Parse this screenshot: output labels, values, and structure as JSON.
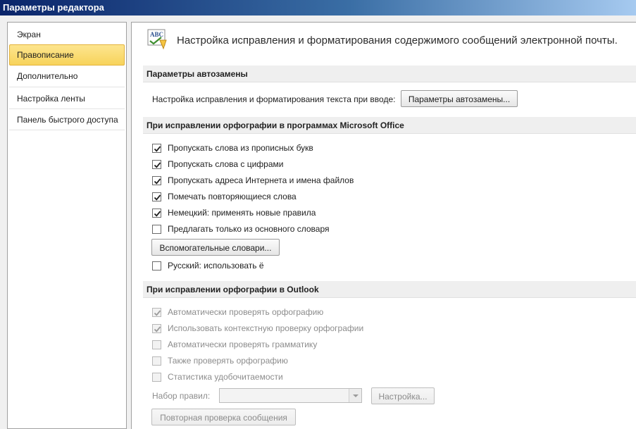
{
  "window": {
    "title": "Параметры редактора"
  },
  "sidebar": {
    "items": [
      {
        "label": "Экран",
        "active": false
      },
      {
        "label": "Правописание",
        "active": true
      },
      {
        "label": "Дополнительно",
        "active": false
      },
      {
        "label": "Настройка ленты",
        "active": false
      },
      {
        "label": "Панель быстрого доступа",
        "active": false
      }
    ]
  },
  "header": {
    "icon_text": "ABC",
    "text": "Настройка исправления и форматирования содержимого сообщений электронной почты."
  },
  "autocorrect": {
    "title": "Параметры автозамены",
    "row_label": "Настройка исправления и форматирования текста при вводе:",
    "button_label": "Параметры автозамены..."
  },
  "office_spelling": {
    "title": "При исправлении орфографии в программах Microsoft Office",
    "options": [
      {
        "label": "Пропускать слова из прописных букв",
        "checked": true
      },
      {
        "label": "Пропускать слова с цифрами",
        "checked": true
      },
      {
        "label": "Пропускать адреса Интернета и имена файлов",
        "checked": true
      },
      {
        "label": "Помечать повторяющиеся слова",
        "checked": true
      },
      {
        "label": "Немецкий: применять новые правила",
        "checked": true
      },
      {
        "label": "Предлагать только из основного словаря",
        "checked": false
      }
    ],
    "dictionaries_button": "Вспомогательные словари...",
    "russian_option": {
      "label": "Русский: использовать ё",
      "checked": false
    }
  },
  "outlook_spelling": {
    "title": "При исправлении орфографии в Outlook",
    "options": [
      {
        "label": "Автоматически проверять орфографию",
        "checked": true,
        "enabled": false
      },
      {
        "label": "Использовать контекстную проверку орфографии",
        "checked": true,
        "enabled": false
      },
      {
        "label": "Автоматически проверять грамматику",
        "checked": false,
        "enabled": false
      },
      {
        "label": "Также проверять орфографию",
        "checked": false,
        "enabled": false
      },
      {
        "label": "Статистика удобочитаемости",
        "checked": false,
        "enabled": false
      }
    ],
    "ruleset_label": "Набор правил:",
    "ruleset_value": "",
    "settings_button": "Настройка...",
    "recheck_button": "Повторная проверка сообщения"
  },
  "colors": {
    "active_nav": "#f7d35b",
    "titlebar": "#0a246a",
    "section_bg": "#efefef"
  }
}
